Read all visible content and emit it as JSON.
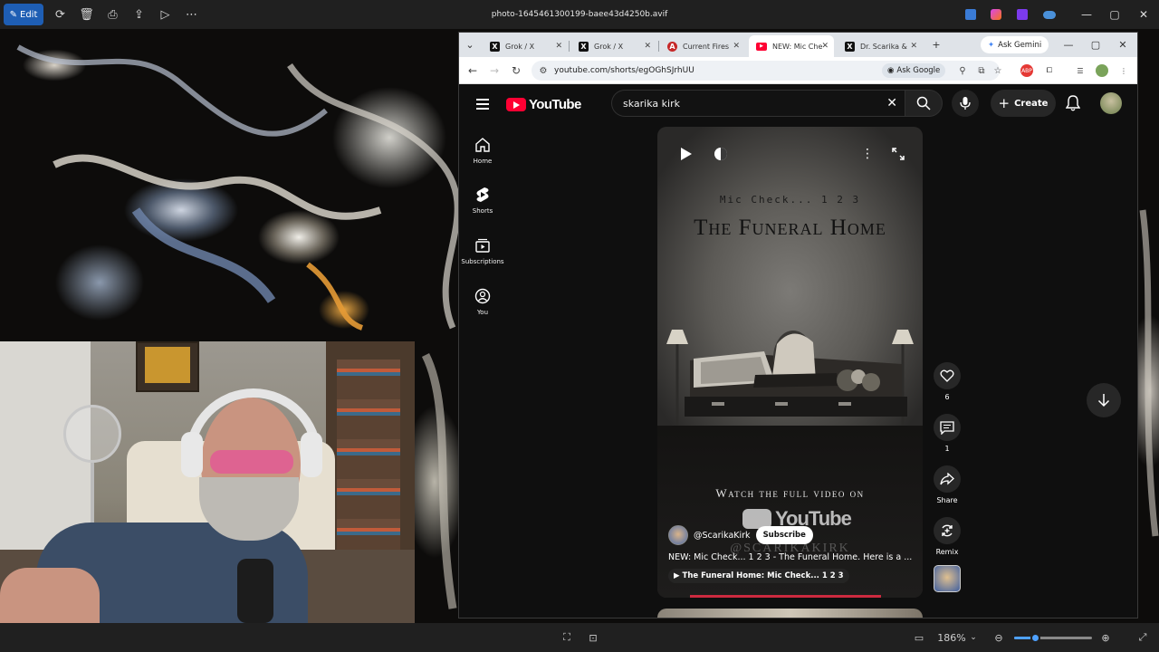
{
  "viewer": {
    "edit_label": "Edit",
    "filename": "photo-1645461300199-baee43d4250b.avif",
    "zoom": "186%"
  },
  "browser": {
    "tabs": [
      {
        "label": "Grok / X",
        "icon": "x-logo-icon",
        "active": false
      },
      {
        "label": "Grok / X",
        "icon": "x-logo-icon",
        "active": false
      },
      {
        "label": "Current Fires",
        "icon": "fire-icon",
        "active": false
      },
      {
        "label": "NEW: Mic Che",
        "icon": "youtube-icon",
        "active": true
      },
      {
        "label": "Dr. Scarika &",
        "icon": "x-logo-icon",
        "active": false
      }
    ],
    "ask_gemini": "Ask Gemini",
    "url": "youtube.com/shorts/egOGhSJrhUU",
    "ask_google": "Ask Google"
  },
  "youtube": {
    "logo_text": "YouTube",
    "search_value": "skarika kirk",
    "create_label": "Create",
    "sidebar": [
      {
        "label": "Home",
        "icon": "home-icon"
      },
      {
        "label": "Shorts",
        "icon": "shorts-icon"
      },
      {
        "label": "Subscriptions",
        "icon": "subscriptions-icon"
      },
      {
        "label": "You",
        "icon": "you-icon"
      }
    ],
    "short": {
      "overlay_subtitle": "Mic Check... 1 2 3",
      "overlay_title": "The Funeral Home",
      "overlay_watch": "Watch the full video on",
      "overlay_yt": "YouTube",
      "overlay_handle": "@SCARIKAKIRK",
      "channel": "@ScarikaKirk",
      "subscribe_label": "Subscribe",
      "description": "NEW: Mic Check... 1 2 3 - The Funeral Home. Here is a ...",
      "linked_video": "The Funeral Home: Mic Check... 1 2 3",
      "progress": 0.72
    },
    "actions": {
      "likes": "6",
      "comments": "1",
      "share_label": "Share",
      "remix_label": "Remix"
    }
  }
}
